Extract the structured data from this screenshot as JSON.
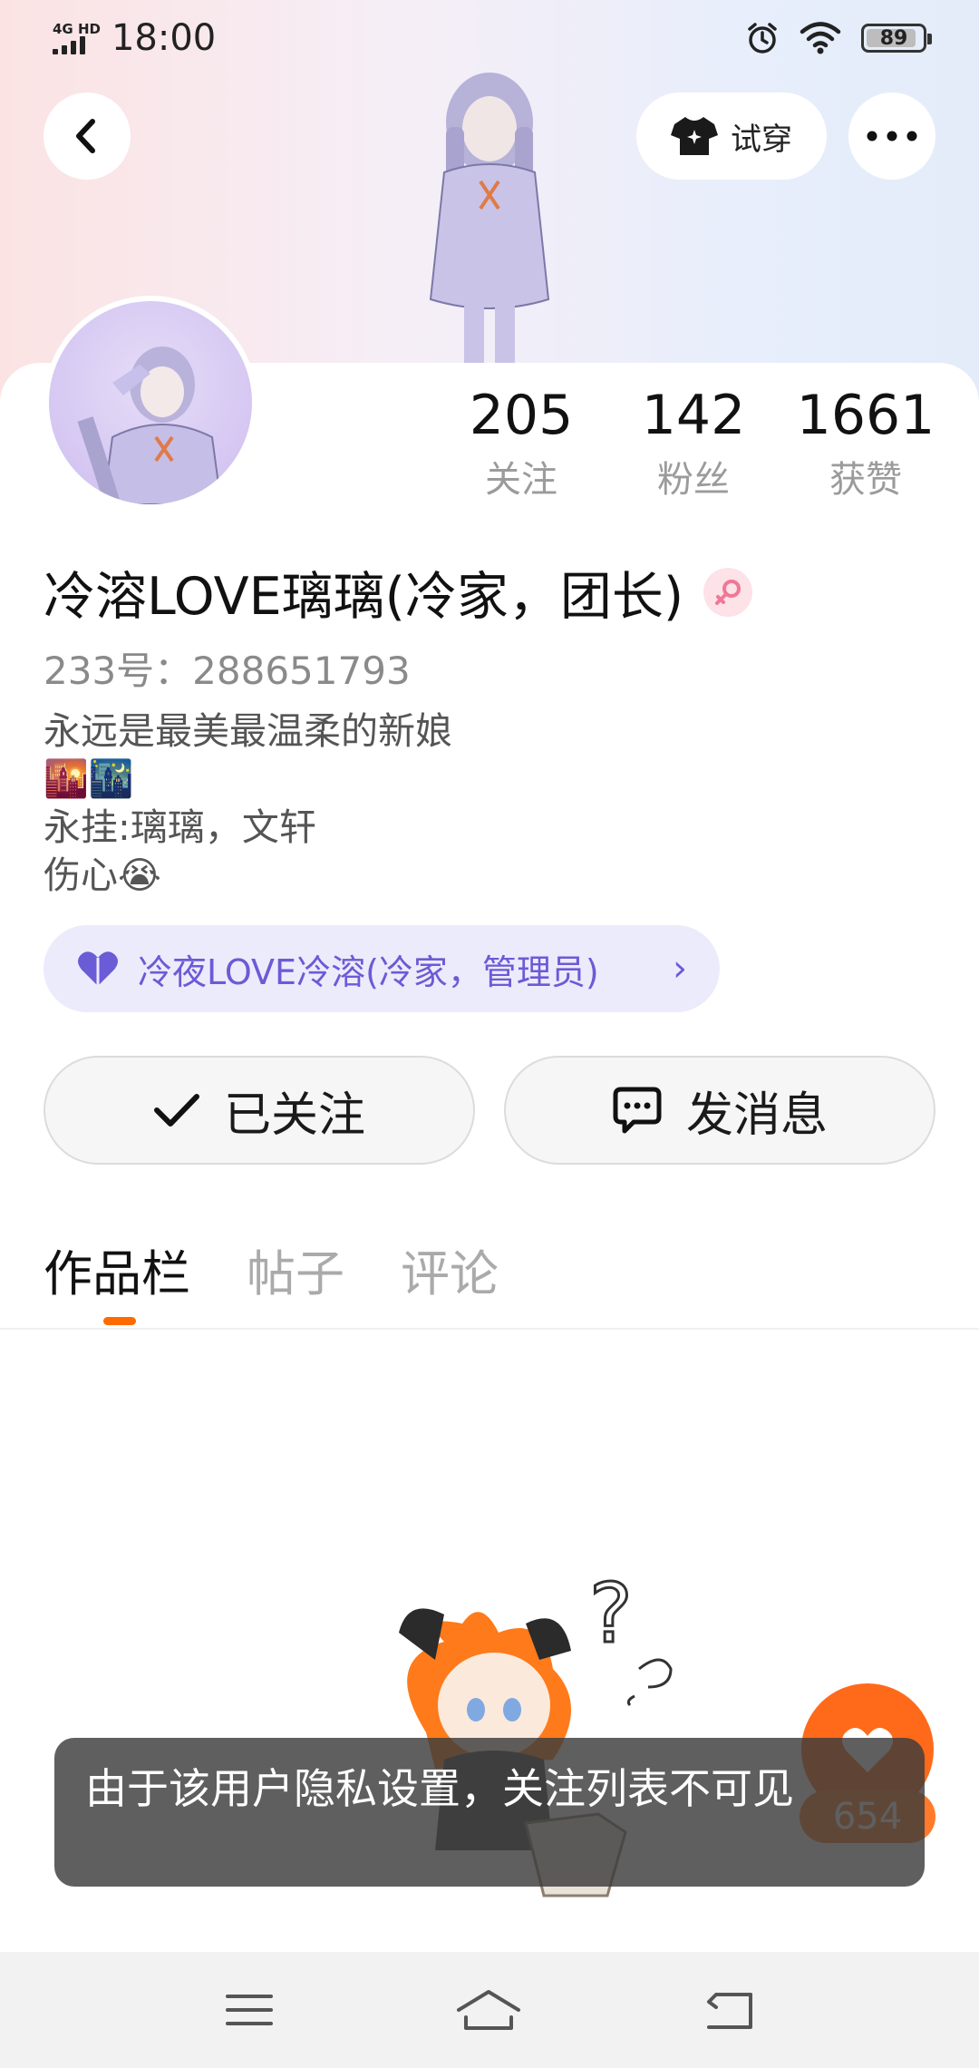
{
  "status_bar": {
    "network": "4G HD",
    "time": "18:00",
    "battery": "89"
  },
  "header": {
    "try_on_label": "试穿"
  },
  "profile": {
    "stats": [
      {
        "value": "205",
        "label": "关注"
      },
      {
        "value": "142",
        "label": "粉丝"
      },
      {
        "value": "1661",
        "label": "获赞"
      }
    ],
    "username": "冷溶LOVE璃璃(冷家，团长)",
    "uid": "233号：288651793",
    "bio_lines": [
      "永远是最美最温柔的新娘",
      "🌇🌃",
      "永挂:璃璃，文轩",
      "伤心😭"
    ],
    "group_label": "冷夜LOVE冷溶(冷家，管理员)"
  },
  "actions": {
    "follow_label": "已关注",
    "message_label": "发消息"
  },
  "tabs": [
    {
      "label": "作品栏",
      "active": true
    },
    {
      "label": "帖子",
      "active": false
    },
    {
      "label": "评论",
      "active": false
    }
  ],
  "like_count": "654",
  "toast": "由于该用户隐私设置，关注列表不可见",
  "colors": {
    "accent": "#ff6a00",
    "pill_text": "#6a5bd6",
    "pill_bg": "#ecebfb"
  }
}
